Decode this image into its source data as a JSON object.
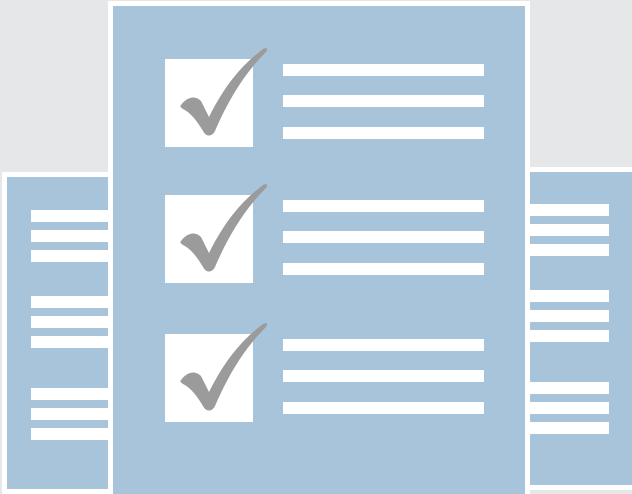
{
  "colors": {
    "background": "#e6e7e9",
    "document": "#a8c4da",
    "border": "#ffffff",
    "line": "#ffffff",
    "checkbox": "#ffffff",
    "checkmark": "#9b9b9b"
  },
  "icons": {
    "main": "checklist-document-icon",
    "side": "text-document-icon",
    "check": "checkmark-icon"
  },
  "checklist": {
    "items": [
      {
        "checked": true
      },
      {
        "checked": true
      },
      {
        "checked": true
      }
    ]
  }
}
